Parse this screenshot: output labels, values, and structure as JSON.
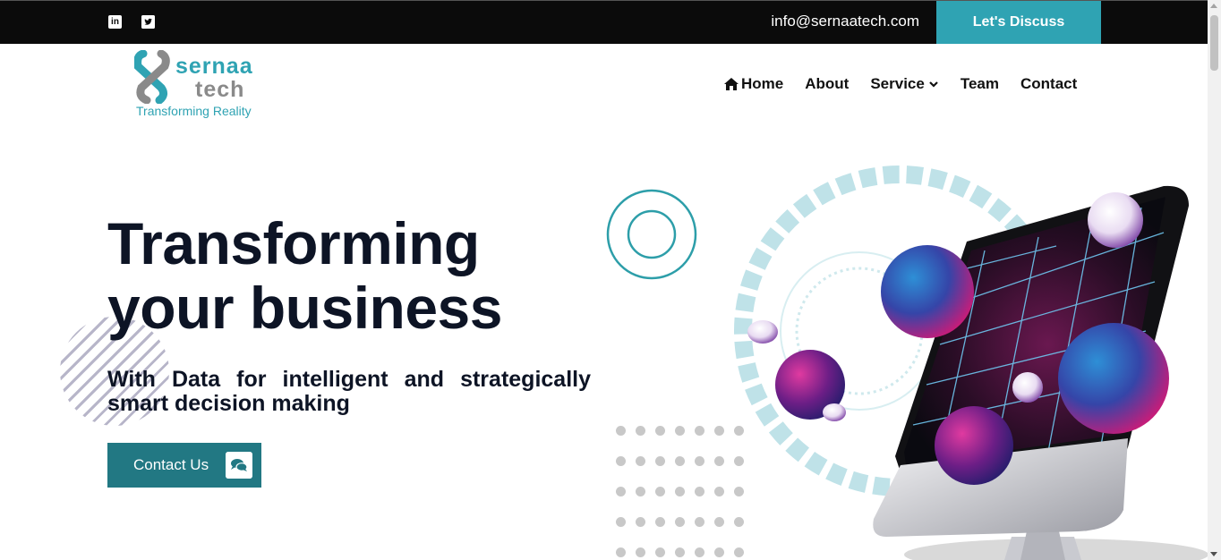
{
  "topbar": {
    "social": [
      {
        "name": "linkedin",
        "label": "in"
      },
      {
        "name": "twitter",
        "label": "t"
      }
    ],
    "email": "info@sernaatech.com",
    "cta_label": "Let's Discuss",
    "background": "#0b0b0b",
    "accent": "#2fa3b3"
  },
  "logo": {
    "word1": "sernaa",
    "word2": "tech",
    "tagline": "Transforming Reality"
  },
  "nav": {
    "items": [
      {
        "label": "Home",
        "icon": "home-icon"
      },
      {
        "label": "About"
      },
      {
        "label": "Service",
        "icon": "chevron-down-icon"
      },
      {
        "label": "Team"
      },
      {
        "label": "Contact"
      }
    ]
  },
  "hero": {
    "title_line1": "Transforming",
    "title_line2": "your business",
    "subtitle": "With Data for intelligent and strategically smart decision making",
    "cta_label": "Contact Us",
    "cta_icon": "chat-icon",
    "cta_color": "#227883"
  }
}
